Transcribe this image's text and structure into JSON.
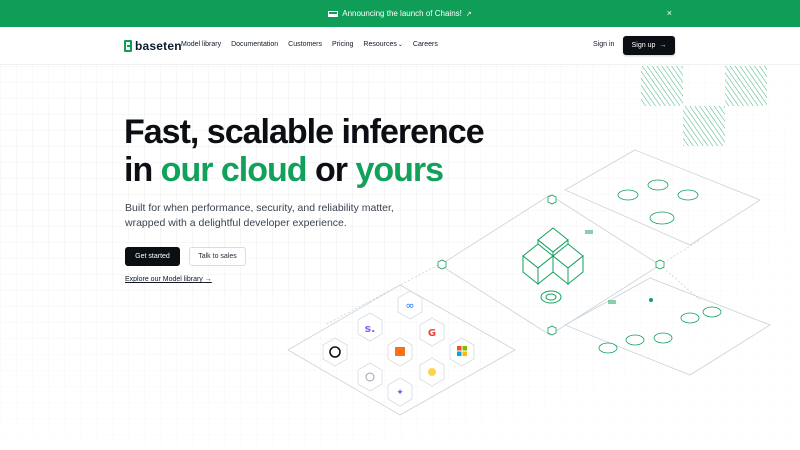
{
  "banner": {
    "text": "Announcing the launch of Chains!",
    "external_icon": "external-link-icon",
    "close_glyph": "×"
  },
  "nav": {
    "logo_text": "baseten",
    "links": [
      {
        "label": "Model library"
      },
      {
        "label": "Documentation"
      },
      {
        "label": "Customers"
      },
      {
        "label": "Pricing"
      },
      {
        "label": "Resources",
        "has_dropdown": true
      },
      {
        "label": "Careers"
      }
    ],
    "signin": "Sign in",
    "signup": "Sign up"
  },
  "hero": {
    "title_1": "Fast, scalable inference",
    "title_2_in": "in ",
    "title_2_cloud": "our cloud",
    "title_2_or": " or ",
    "title_2_yours": "yours",
    "subtitle_1": "Built for when performance, security, and reliability matter,",
    "subtitle_2": "wrapped with a delightful developer experience.",
    "cta_primary": "Get started",
    "cta_secondary": "Talk to sales",
    "explore_link": "Explore our Model library"
  },
  "colors": {
    "brand_green": "#0f9d58",
    "accent_green": "#11a15b",
    "dark": "#0b0f14"
  },
  "illustration": {
    "model_icons": [
      "meta-logo-icon",
      "s-logo-icon",
      "google-logo-icon",
      "stability-icon",
      "mistral-icon",
      "microsoft-icon",
      "hexagon-icon",
      "sparkle-icon",
      "cluster-icon"
    ]
  }
}
